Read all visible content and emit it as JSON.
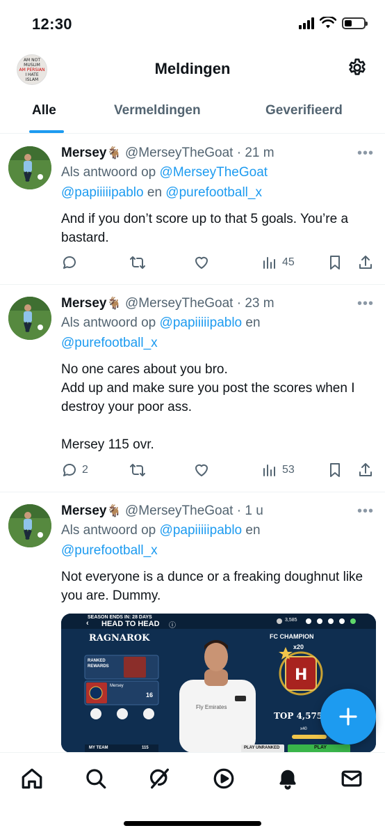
{
  "status": {
    "time": "12:30"
  },
  "header": {
    "title": "Meldingen",
    "avatar_text": [
      "AM NOT",
      "MUSLIM",
      "AM PERSIAN",
      "I HATE",
      "ISLAM"
    ]
  },
  "tabs": [
    {
      "label": "Alle",
      "active": true
    },
    {
      "label": "Vermeldingen",
      "active": false
    },
    {
      "label": "Geverifieerd",
      "active": false
    }
  ],
  "tweets": [
    {
      "name": "Mersey",
      "emoji": "🐐",
      "handle": "@MerseyTheGoat",
      "time": "21 m",
      "reply_prefix": "Als antwoord op",
      "reply_line1": "@MerseyTheGoat",
      "reply_line2a": "@papiiiiipablo",
      "reply_and": "en",
      "reply_line2b": "@purefootball_x",
      "text": "And if you don’t score up to that 5 goals. You’re a bastard.",
      "replies": "",
      "views": "45"
    },
    {
      "name": "Mersey",
      "emoji": "🐐",
      "handle": "@MerseyTheGoat",
      "time": "23 m",
      "reply_prefix": "Als antwoord op",
      "reply_a": "@papiiiiipablo",
      "reply_and": "en",
      "reply_b": "@purefootball_x",
      "text": "No one cares about you bro.\nAdd up and make sure you post the scores when I destroy your poor ass.\n\nMersey 115 ovr.",
      "replies": "2",
      "views": "53"
    },
    {
      "name": "Mersey",
      "emoji": "🐐",
      "handle": "@MerseyTheGoat",
      "time": "1 u",
      "reply_prefix": "Als antwoord op",
      "reply_a": "@papiiiiipablo",
      "reply_and": "en",
      "reply_b": "@purefootball_x",
      "text": "Not everyone is a dunce or a freaking doughnut like you are. Dummy.",
      "media": {
        "season_label": "SEASON ENDS IN: 28 DAYS",
        "mode_title": "HEAD TO HEAD",
        "coins": "3,585",
        "event_name": "RAGNAROK",
        "ranked_label": "RANKED REWARDS",
        "player_label": "Mersey",
        "player_count": "16",
        "champion_label": "FC CHAMPION",
        "champion_count": "x20",
        "top_rank": "TOP 4,575",
        "my_team": "MY TEAM",
        "my_team_ovr": "115",
        "play_unranked": "PLAY UNRANKED",
        "play": "PLAY",
        "shirt_sponsor": "Fly Emirates",
        "badge_count": "x40"
      }
    }
  ],
  "nav": [
    "home-icon",
    "search-icon",
    "grok-icon",
    "video-icon",
    "notifications-icon",
    "messages-icon"
  ]
}
